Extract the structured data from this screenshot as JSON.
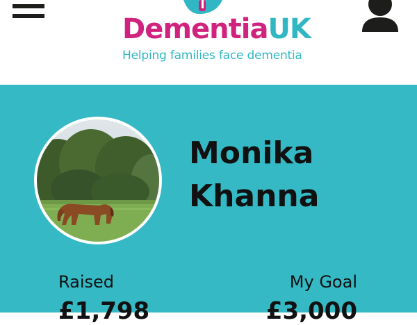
{
  "header": {
    "menu_icon": "hamburger-menu-icon",
    "account_icon": "user-account-icon",
    "logo": {
      "word_part1": "Dementia",
      "word_part2": "UK",
      "tagline": "Helping families face dementia",
      "colors": {
        "magenta": "#d0237d",
        "teal": "#31b7c4"
      }
    }
  },
  "profile": {
    "name_line1": "Monika",
    "name_line2": "Khanna",
    "avatar_alt": "profile photo of a horse grazing in a field",
    "raised_label": "Raised",
    "raised_value": "£1,798",
    "goal_label": "My Goal",
    "goal_value": "£3,000"
  },
  "colors": {
    "panel_background": "#34b9c5",
    "header_background": "#ffffff",
    "text": "#111111"
  }
}
